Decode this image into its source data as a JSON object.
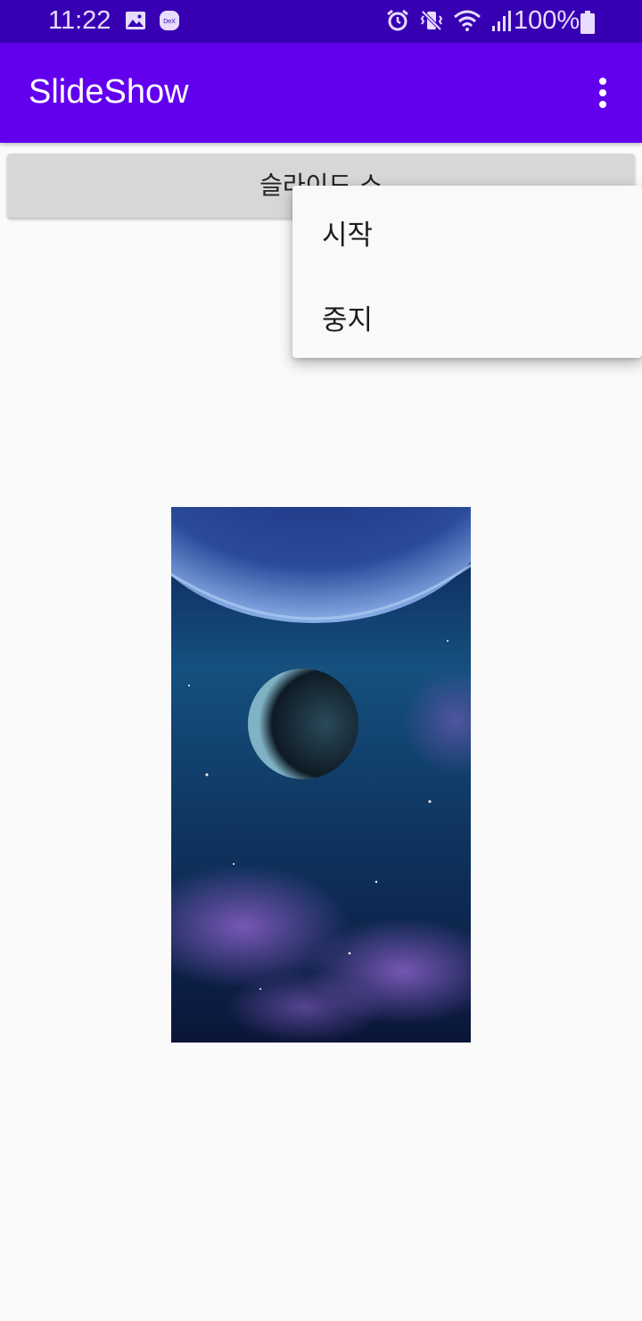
{
  "status_bar": {
    "time": "11:22",
    "battery": "100%",
    "left_icons": [
      "image-icon",
      "dex-icon"
    ],
    "right_icons": [
      "alarm-icon",
      "vibrate-mute-icon",
      "wifi-icon",
      "signal-icon",
      "battery-icon"
    ],
    "dex_label": "DeX",
    "background": "#3700b3"
  },
  "app_bar": {
    "title": "SlideShow",
    "overflow_icon": "more-vert-icon",
    "background": "#6200ee"
  },
  "main": {
    "slide_button_label": "슬라이드 쇼",
    "image": "space-planets-image"
  },
  "overflow_menu": {
    "items": [
      {
        "label": "시작"
      },
      {
        "label": "중지"
      }
    ]
  }
}
